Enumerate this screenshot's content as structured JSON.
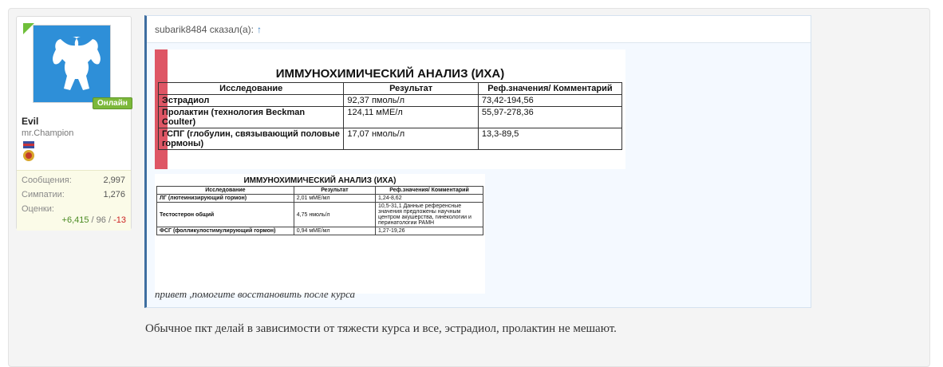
{
  "user": {
    "status_badge": "Онлайн",
    "name": "Evil",
    "title": "mr.Champion",
    "stats": [
      {
        "label": "Сообщения:",
        "value": "2,997"
      },
      {
        "label": "Симпатии:",
        "value": "1,276"
      },
      {
        "label": "Оценки:",
        "value": ""
      }
    ],
    "rating": {
      "positive": "+6,415",
      "sep1": " / ",
      "neutral": "96",
      "sep2": " / ",
      "negative": "-13"
    }
  },
  "quote": {
    "author": "subarik8484 сказал(а):",
    "arrow": "↑",
    "text": "привет ,помогите восстановить после курса",
    "table1": {
      "title": "ИММУНОХИМИЧЕСКИЙ АНАЛИЗ (ИХА)",
      "headers": [
        "Исследование",
        "Результат",
        "Реф.значения/ Комментарий"
      ],
      "rows": [
        [
          "Эстрадиол",
          "92,37 пмоль/л",
          "73,42-194,56"
        ],
        [
          "Пролактин (технология Beckman Coulter)",
          "124,11 мМЕ/л",
          "55,97-278,36"
        ],
        [
          "ГСПГ (глобулин, связывающий половые гормоны)",
          "17,07 нмоль/л",
          "13,3-89,5"
        ]
      ]
    },
    "table2": {
      "title": "ИММУНОХИМИЧЕСКИЙ АНАЛИЗ (ИХА)",
      "headers": [
        "Исследование",
        "Результат",
        "Реф.значения/ Комментарий"
      ],
      "rows": [
        [
          "ЛГ (лютеинизирующий гормон)",
          "2,01 мМЕ/мл",
          "1,24-8,62"
        ],
        [
          "Тестостерон общий",
          "4,75 нмоль/л",
          "10,5-31,1 Данные референсные значения предложены научным центром акушерства, гинекологии и перинатологии РАМН"
        ],
        [
          "ФСГ (фолликулостимулирующий гормон)",
          "0,94 мМЕ/мл",
          "1,27-19,26"
        ]
      ]
    }
  },
  "reply": {
    "text": "Обычное пкт делай в зависимости от тяжести курса и все, эстрадиол, пролактин не мешают."
  },
  "colors": {
    "accent": "#2e8fd8",
    "online": "#7cb83a",
    "quote_border": "#3e6ea0"
  }
}
